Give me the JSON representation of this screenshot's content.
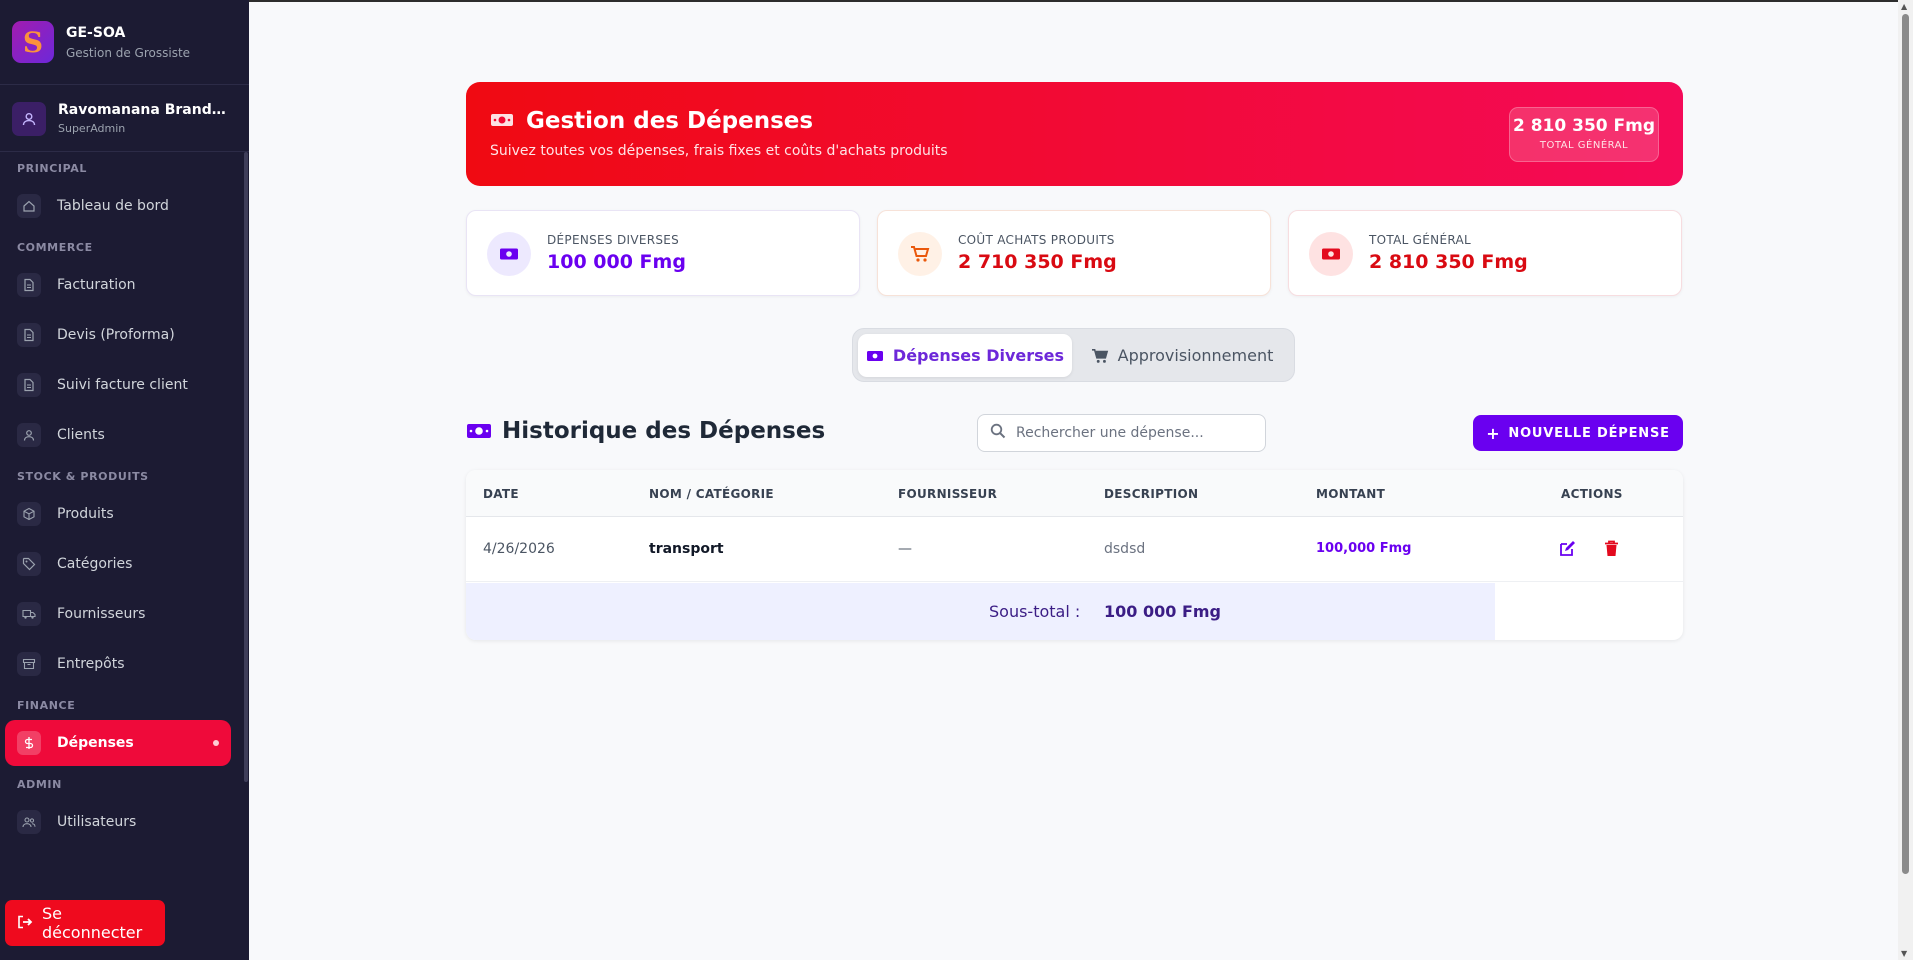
{
  "app": {
    "name": "GE-SOA",
    "subtitle": "Gestion de Grossiste",
    "logo_letter": "S"
  },
  "user": {
    "name": "Ravomanana Brandon Fi...",
    "role": "SuperAdmin"
  },
  "sidebar": {
    "sections": [
      {
        "title": "PRINCIPAL",
        "items": [
          {
            "label": "Tableau de bord",
            "icon": "home-icon"
          }
        ]
      },
      {
        "title": "COMMERCE",
        "items": [
          {
            "label": "Facturation",
            "icon": "document-icon"
          },
          {
            "label": "Devis (Proforma)",
            "icon": "document-icon"
          },
          {
            "label": "Suivi facture client",
            "icon": "document-icon"
          },
          {
            "label": "Clients",
            "icon": "user-icon"
          }
        ]
      },
      {
        "title": "STOCK & PRODUITS",
        "items": [
          {
            "label": "Produits",
            "icon": "cube-icon"
          },
          {
            "label": "Catégories",
            "icon": "tag-icon"
          },
          {
            "label": "Fournisseurs",
            "icon": "truck-icon"
          },
          {
            "label": "Entrepôts",
            "icon": "archive-icon"
          }
        ]
      },
      {
        "title": "FINANCE",
        "items": [
          {
            "label": "Dépenses",
            "icon": "dollar-icon",
            "active": true
          }
        ]
      },
      {
        "title": "ADMIN",
        "items": [
          {
            "label": "Utilisateurs",
            "icon": "users-icon"
          }
        ]
      }
    ],
    "logout_label": "Se déconnecter"
  },
  "hero": {
    "title": "Gestion des Dépenses",
    "subtitle": "Suivez toutes vos dépenses, frais fixes et coûts d'achats produits",
    "total_value": "2 810 350 Fmg",
    "total_label": "TOTAL GÉNÉRAL"
  },
  "cards": [
    {
      "label": "DÉPENSES DIVERSES",
      "value": "100 000 Fmg",
      "color": "#6a00f0",
      "icon": "money-icon"
    },
    {
      "label": "COÛT ACHATS PRODUITS",
      "value": "2 710 350 Fmg",
      "color": "#d90a12",
      "icon": "cart-icon"
    },
    {
      "label": "TOTAL GÉNÉRAL",
      "value": "2 810 350 Fmg",
      "color": "#d90a12",
      "icon": "money-icon"
    }
  ],
  "tabs": [
    {
      "label": "Dépenses Diverses",
      "active": true
    },
    {
      "label": "Approvisionnement",
      "active": false
    }
  ],
  "history": {
    "title": "Historique des Dépenses",
    "search_placeholder": "Rechercher une dépense...",
    "new_button": "NOUVELLE DÉPENSE"
  },
  "table": {
    "headers": [
      "DATE",
      "NOM / CATÉGORIE",
      "FOURNISSEUR",
      "DESCRIPTION",
      "MONTANT",
      "ACTIONS"
    ],
    "rows": [
      {
        "date": "4/26/2026",
        "name": "transport",
        "supplier": "—",
        "description": "dsdsd",
        "amount": "100,000 Fmg"
      }
    ],
    "subtotal_label": "Sous-total :",
    "subtotal_value": "100 000 Fmg"
  },
  "colors": {
    "sidebar_bg": "#1c1b33",
    "accent_red": "#ef0a3a",
    "accent_purple": "#6a00f0"
  }
}
